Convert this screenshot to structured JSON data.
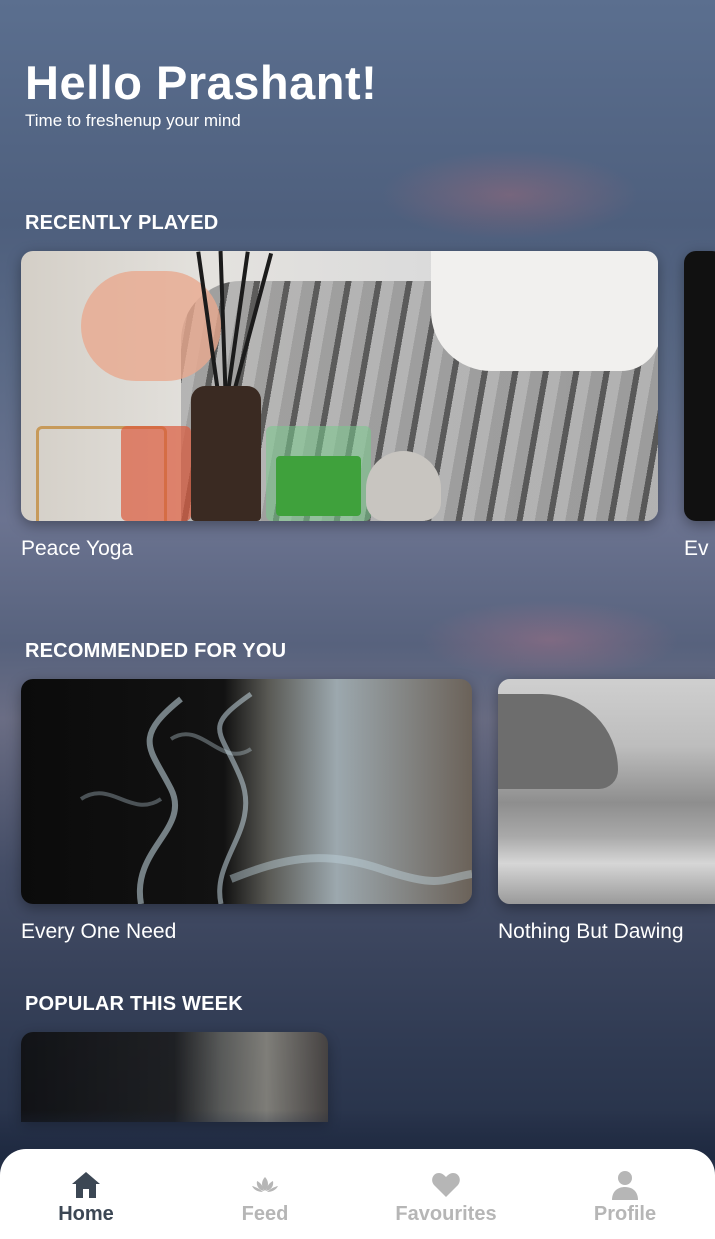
{
  "header": {
    "greeting": "Hello Prashant!",
    "subtitle": "Time to freshenup your mind"
  },
  "sections": {
    "recently_played": {
      "title": "RECENTLY PLAYED",
      "items": [
        {
          "title": "Peace Yoga"
        },
        {
          "title": "Ev"
        }
      ]
    },
    "recommended": {
      "title": "RECOMMENDED FOR YOU",
      "items": [
        {
          "title": "Every One Need"
        },
        {
          "title": "Nothing But Dawing"
        }
      ]
    },
    "popular": {
      "title": "POPULAR THIS WEEK"
    }
  },
  "tabbar": {
    "active_color": "#3c4754",
    "inactive_color": "#b6b6b6",
    "tabs": [
      {
        "label": "Home",
        "icon": "home-icon",
        "active": true
      },
      {
        "label": "Feed",
        "icon": "lotus-icon",
        "active": false
      },
      {
        "label": "Favourites",
        "icon": "heart-icon",
        "active": false
      },
      {
        "label": "Profile",
        "icon": "user-icon",
        "active": false
      }
    ]
  }
}
